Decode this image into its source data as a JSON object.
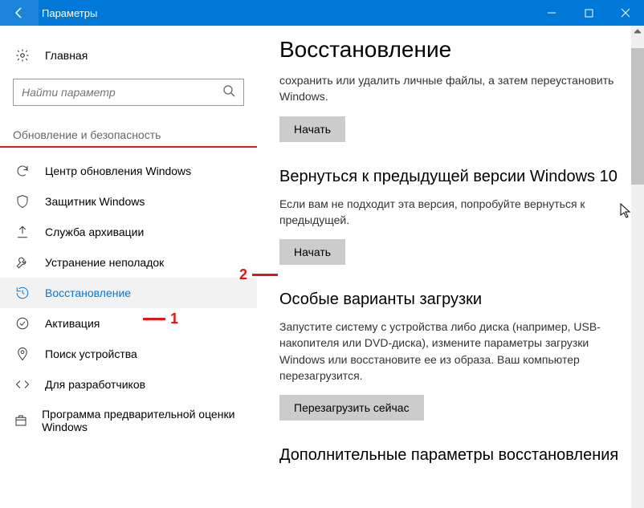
{
  "titlebar": {
    "title": "Параметры"
  },
  "sidebar": {
    "home": "Главная",
    "search_placeholder": "Найти параметр",
    "category": "Обновление и безопасность",
    "items": [
      {
        "label": "Центр обновления Windows"
      },
      {
        "label": "Защитник Windows"
      },
      {
        "label": "Служба архивации"
      },
      {
        "label": "Устранение неполадок"
      },
      {
        "label": "Восстановление",
        "selected": true
      },
      {
        "label": "Активация"
      },
      {
        "label": "Поиск устройства"
      },
      {
        "label": "Для разработчиков"
      },
      {
        "label": "Программа предварительной оценки Windows"
      }
    ]
  },
  "content": {
    "heading": "Восстановление",
    "partial_top_desc": "сохранить или удалить личные файлы, а затем переустановить Windows.",
    "btn_start": "Начать",
    "sect_prev": {
      "title": "Вернуться к предыдущей версии Windows 10",
      "desc": "Если вам не подходит эта версия, попробуйте вернуться к предыдущей.",
      "btn": "Начать"
    },
    "sect_boot": {
      "title": "Особые варианты загрузки",
      "desc": "Запустите систему с устройства либо диска (например, USB-накопителя или DVD-диска), измените параметры загрузки Windows или восстановите ее из образа. Ваш компьютер перезагрузится.",
      "btn": "Перезагрузить сейчас"
    },
    "sect_more": {
      "title": "Дополнительные параметры восстановления"
    }
  },
  "annotations": {
    "one": "1",
    "two": "2"
  }
}
